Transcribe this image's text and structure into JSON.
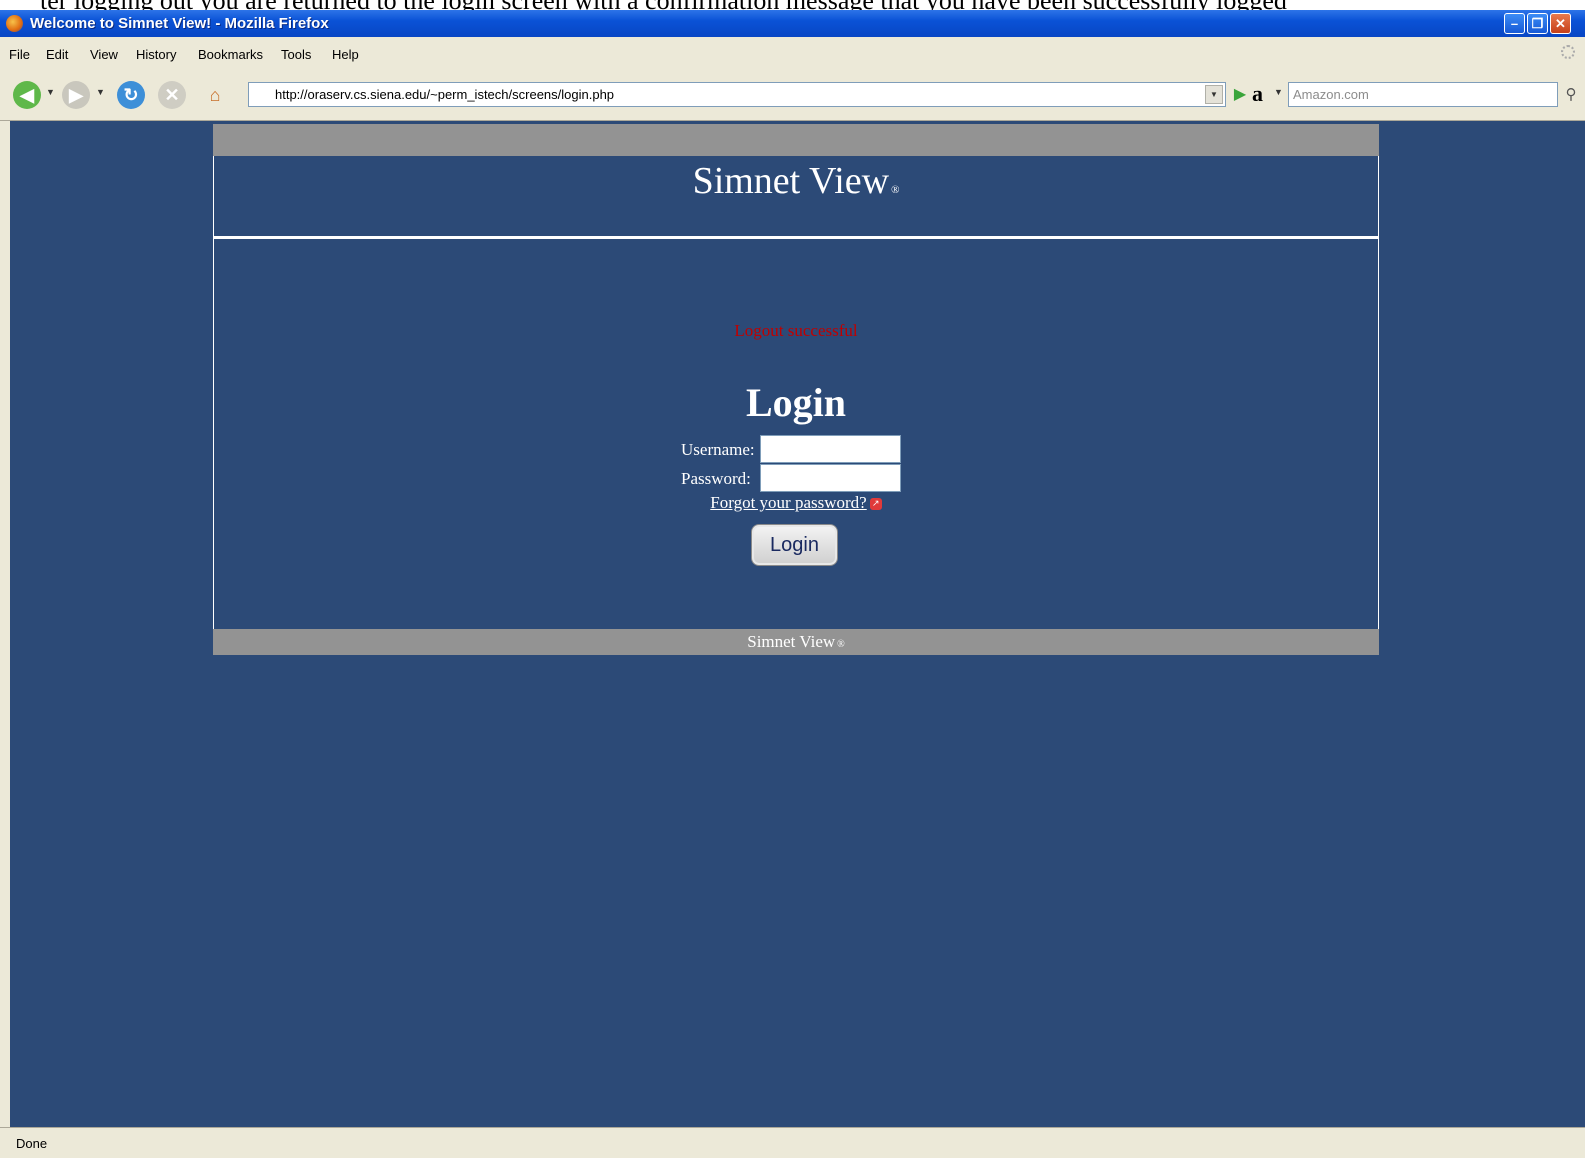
{
  "caption": {
    "partial_text": "ter logging out you are returned to the login screen with a confirmation message that you have been successfully logged"
  },
  "window": {
    "title": "Welcome to Simnet View! - Mozilla Firefox",
    "app_icon": "firefox-icon",
    "controls": {
      "minimize": "minimize-icon",
      "restore": "restore-icon",
      "close": "close-icon"
    }
  },
  "menu": {
    "items": [
      {
        "label": "File"
      },
      {
        "label": "Edit"
      },
      {
        "label": "View"
      },
      {
        "label": "History"
      },
      {
        "label": "Bookmarks"
      },
      {
        "label": "Tools"
      },
      {
        "label": "Help"
      }
    ]
  },
  "toolbar": {
    "back_icon": "back-arrow-icon",
    "forward_icon": "forward-arrow-icon",
    "reload_icon": "reload-icon",
    "stop_icon": "stop-icon",
    "home_icon": "home-icon",
    "url": "http://oraserv.cs.siena.edu/~perm_istech/screens/login.php",
    "go_icon": "go-arrow-icon",
    "search_engine_icon": "amazon-icon",
    "search_placeholder": "Amazon.com",
    "search_icon": "magnifier-icon"
  },
  "page": {
    "site_title": "Simnet View",
    "registered_mark": "®",
    "logout_message": "Logout successful",
    "login_heading": "Login",
    "username_label": "Username:",
    "username_value": "",
    "password_label": "Password:",
    "password_value": "",
    "forgot_link": "Forgot your password?",
    "login_button": "Login",
    "footer_text": "Simnet View",
    "footer_mark": "®"
  },
  "colors": {
    "page_background": "#2c4a77",
    "band_gray": "#939393",
    "message_red": "#c00000",
    "titlebar_blue": "#0a52d6"
  },
  "status": {
    "text": "Done"
  }
}
